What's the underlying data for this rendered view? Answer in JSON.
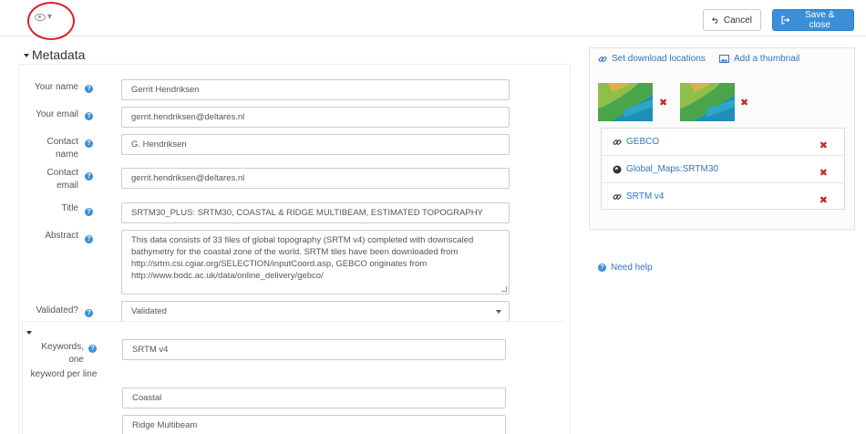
{
  "toolbar": {
    "view_icon": "eye-icon",
    "cancel_label": "Cancel",
    "save_label": "Save & close"
  },
  "metadata": {
    "title": "Metadata",
    "fields": {
      "your_name": {
        "label": "Your name",
        "value": "Gerrit Hendriksen"
      },
      "your_email": {
        "label": "Your email",
        "value": "gerrit.hendriksen@deltares.nl"
      },
      "contact_name": {
        "label_1": "Contact",
        "label_2": "name",
        "value": "G. Hendriksen"
      },
      "contact_email": {
        "label_1": "Contact",
        "label_2": "email",
        "value": "gerrit.hendriksen@deltares.nl"
      },
      "title": {
        "label": "Title",
        "value": "SRTM30_PLUS: SRTM30, COASTAL & RIDGE MULTIBEAM, ESTIMATED TOPOGRAPHY"
      },
      "abstract": {
        "label": "Abstract",
        "lines": [
          "This data consists of 33 files of global topography (SRTM v4) completed with downscaled",
          "bathymetry for the coastal zone of the world. SRTM tiles have been downloaded from",
          "http://srtm.csi.cgiar.org/SELECTION/inputCoord.asp, GEBCO originates from",
          "http://www.bodc.ac.uk/data/online_delivery/gebco/"
        ]
      },
      "validated": {
        "label": "Validated?",
        "value": "Validated"
      }
    },
    "keywords": {
      "label_1": "Keywords,",
      "label_2": "one",
      "label_3": "keyword per line",
      "values": [
        "SRTM v4",
        "Coastal",
        "Ridge Multibeam"
      ]
    }
  },
  "sidebar": {
    "set_download_label": "Set download locations",
    "add_thumbnail_label": "Add a thumbnail",
    "resources": [
      {
        "name": "GEBCO",
        "icon": "link-icon"
      },
      {
        "name": "Global_Maps:SRTM30",
        "icon": "globe-icon"
      },
      {
        "name": "SRTM v4",
        "icon": "link-icon"
      }
    ],
    "need_help_label": "Need help"
  },
  "colors": {
    "primary": "#3a8fd8",
    "link": "#2f75c2",
    "danger": "#c0272d",
    "annotation": "#e01f27"
  }
}
